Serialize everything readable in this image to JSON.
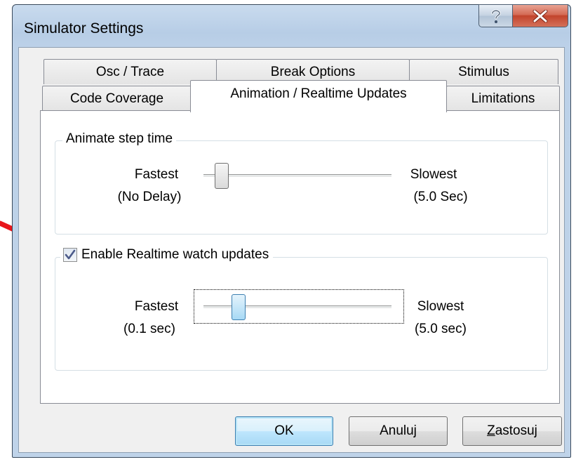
{
  "window": {
    "title": "Simulator Settings",
    "caption_buttons": {
      "help": "?",
      "close": "x"
    }
  },
  "tabs": {
    "row_back": [
      "Osc / Trace",
      "Break Options",
      "Stimulus"
    ],
    "row_front": [
      "Code Coverage",
      "Animation / Realtime  Updates",
      "Limitations"
    ],
    "active": "Animation / Realtime  Updates"
  },
  "animate": {
    "group_title": "Animate step time",
    "left_label_1": "Fastest",
    "left_label_2": "(No Delay)",
    "right_label_1": "Slowest",
    "right_label_2": "(5.0 Sec)",
    "slider_position_fraction": 0.08
  },
  "realtime": {
    "checkbox_label": "Enable Realtime watch updates",
    "checked": true,
    "left_label_1": "Fastest",
    "left_label_2": "(0.1 sec)",
    "right_label_1": "Slowest",
    "right_label_2": "(5.0 sec)",
    "slider_position_fraction": 0.2
  },
  "buttons": {
    "ok": "OK",
    "cancel": "Anuluj",
    "apply_mnemonic": "Z",
    "apply_rest": "astosuj"
  },
  "colors": {
    "arrow": "#e8161c",
    "default_button_border": "#3c7fb1",
    "close_button": "#c9503a"
  },
  "icons": {
    "arrow": "red-arrow-icon",
    "check": "check-icon",
    "close": "close-icon",
    "help": "help-icon"
  }
}
